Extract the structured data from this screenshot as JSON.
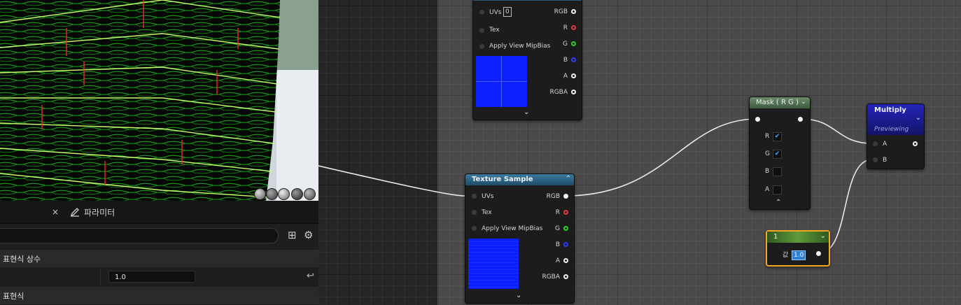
{
  "viewport": {
    "preview_buttons": [
      "sphere",
      "cylinder",
      "plane",
      "cube",
      "custom-mesh"
    ]
  },
  "details": {
    "tab_close": "×",
    "tab_parameters": "파라미터",
    "section_constant": "표현식 상수",
    "constant_value": "1.0",
    "section_expression": "표현식",
    "reset_icon": "↩",
    "grid_icon": "⊞",
    "gear_icon": "⚙"
  },
  "nodes": {
    "top_texture": {
      "uvs_label": "UVs",
      "uvs_value": "0",
      "tex_label": "Tex",
      "mip_label": "Apply View MipBias",
      "outputs": [
        "RGB",
        "R",
        "G",
        "B",
        "A",
        "RGBA"
      ]
    },
    "texture_sample": {
      "title": "Texture Sample",
      "uvs_label": "UVs",
      "tex_label": "Tex",
      "mip_label": "Apply View MipBias",
      "outputs": [
        "RGB",
        "R",
        "G",
        "B",
        "A",
        "RGBA"
      ]
    },
    "mask": {
      "title": "Mask ( R G )",
      "channels": [
        {
          "label": "R",
          "checked": true
        },
        {
          "label": "G",
          "checked": true
        },
        {
          "label": "B",
          "checked": false
        },
        {
          "label": "A",
          "checked": false
        }
      ]
    },
    "multiply": {
      "title": "Multiply",
      "subtitle": "Previewing",
      "input_a": "A",
      "input_b": "B"
    },
    "constant": {
      "title": "1",
      "field_label": "값",
      "value": "1.0"
    }
  },
  "colors": {
    "pin_red": "#e23b3b",
    "pin_green": "#2ed12e",
    "pin_blue": "#2a3bff",
    "texture_header": "#275a7a",
    "mask_header": "#4d6b4d",
    "multiply_header": "#1f1fa8",
    "constant_header": "#3c6b2a",
    "selection": "#f5a623"
  }
}
